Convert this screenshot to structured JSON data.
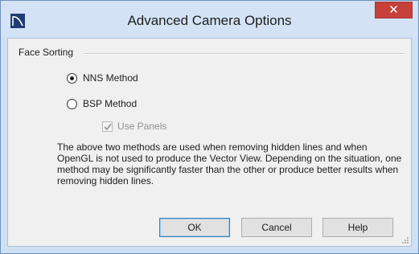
{
  "window": {
    "title": "Advanced Camera Options",
    "close_label": "✕"
  },
  "group": {
    "label": "Face Sorting"
  },
  "options": {
    "nns_label": "NNS Method",
    "nns_checked": true,
    "bsp_label": "BSP Method",
    "bsp_checked": false,
    "use_panels_label": "Use Panels",
    "use_panels_checked": true,
    "use_panels_enabled": false
  },
  "description": "The above two methods are used when removing hidden lines and when OpenGL is not used to produce the Vector View. Depending on the situation, one method may be significantly faster than the other or produce better results when removing hidden lines.",
  "buttons": {
    "ok": "OK",
    "cancel": "Cancel",
    "help": "Help"
  },
  "colors": {
    "close_button": "#c7403a",
    "titlebar": "#d3e3f5",
    "client_bg": "#f0f0f0",
    "default_button_border": "#3c7fb1"
  }
}
